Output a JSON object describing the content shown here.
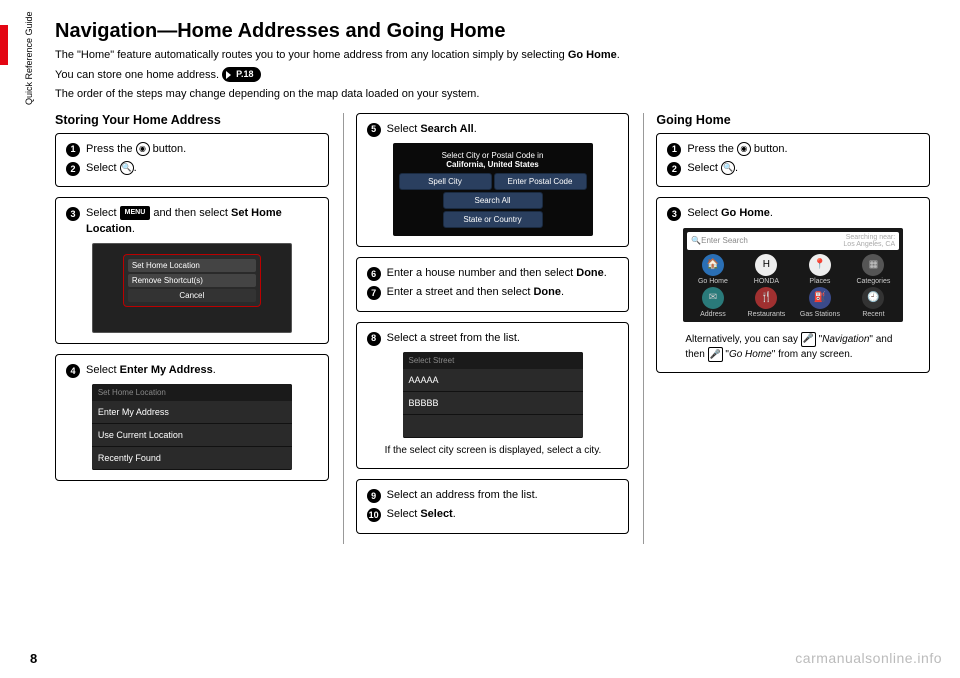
{
  "page_number": "8",
  "side_label": "Quick Reference Guide",
  "watermark": "carmanualsonline.info",
  "title": "Navigation—Home Addresses and Going Home",
  "intro": {
    "line1_pre": "The \"Home\" feature automatically routes you to your home address from any location simply by selecting ",
    "line1_bold": "Go Home",
    "line1_post": ".",
    "line2": "You can store one home address. ",
    "page_ref": "P.18",
    "line3": "The order of the steps may change depending on the map data loaded on your system."
  },
  "col1": {
    "heading": "Storing Your Home Address",
    "step1": "Press the ",
    "step1_btn_glyph": "◉",
    "step1_post": " button.",
    "step2": "Select ",
    "step2_icon": "🔍",
    "step2_post": ".",
    "step3_pre": "Select ",
    "step3_menu": "MENU",
    "step3_mid": " and then select ",
    "step3_bold": "Set Home Location",
    "step3_post": ".",
    "popup": {
      "item1": "Set Home Location",
      "item2": "Remove Shortcut(s)",
      "cancel": "Cancel"
    },
    "step4_pre": "Select ",
    "step4_bold": "Enter My Address",
    "step4_post": ".",
    "list": {
      "hdr": "Set Home Location",
      "r1": "Enter My Address",
      "r2": "Use Current Location",
      "r3": "Recently Found"
    }
  },
  "col2": {
    "step5_pre": "Select ",
    "step5_bold": "Search All",
    "step5_post": ".",
    "city_screen": {
      "top": "Select City or Postal Code in",
      "sub": "California, United States",
      "b1": "Spell City",
      "b2": "Enter Postal Code",
      "b3": "Search All",
      "b4": "State or Country"
    },
    "step6_pre": "Enter a house number and then select ",
    "step6_bold": "Done",
    "step6_post": ".",
    "step7_pre": "Enter a street and then select ",
    "step7_bold": "Done",
    "step7_post": ".",
    "step8": "Select a street from the list.",
    "street_list": {
      "hdr": "Select Street",
      "r1": "AAAAA",
      "r2": "BBBBB"
    },
    "step8_note": "If the select city screen is displayed, select a city.",
    "step9": "Select an address from the list.",
    "step10_pre": "Select ",
    "step10_bold": "Select",
    "step10_post": "."
  },
  "col3": {
    "heading": "Going Home",
    "step1": "Press the ",
    "step1_btn_glyph": "◉",
    "step1_post": " button.",
    "step2": "Select ",
    "step2_icon": "🔍",
    "step2_post": ".",
    "step3_pre": "Select ",
    "step3_bold": "Go Home",
    "step3_post": ".",
    "search": {
      "placeholder": "Enter Search",
      "side1": "Searching near:",
      "side2": "Los Angeles, CA"
    },
    "apps": {
      "a1": "Go Home",
      "a2": "HONDA",
      "a3": "Places",
      "a4": "Categories",
      "a5": "Address",
      "a6": "Restaurants",
      "a7": "Gas Stations",
      "a8": "Recent"
    },
    "note_pre": "Alternatively, you can say ",
    "note_q1": "\"",
    "note_nav": "Navigation",
    "note_mid": "\" and then ",
    "note_q2": "\"",
    "note_go": "Go Home",
    "note_post": "\" from any screen."
  }
}
